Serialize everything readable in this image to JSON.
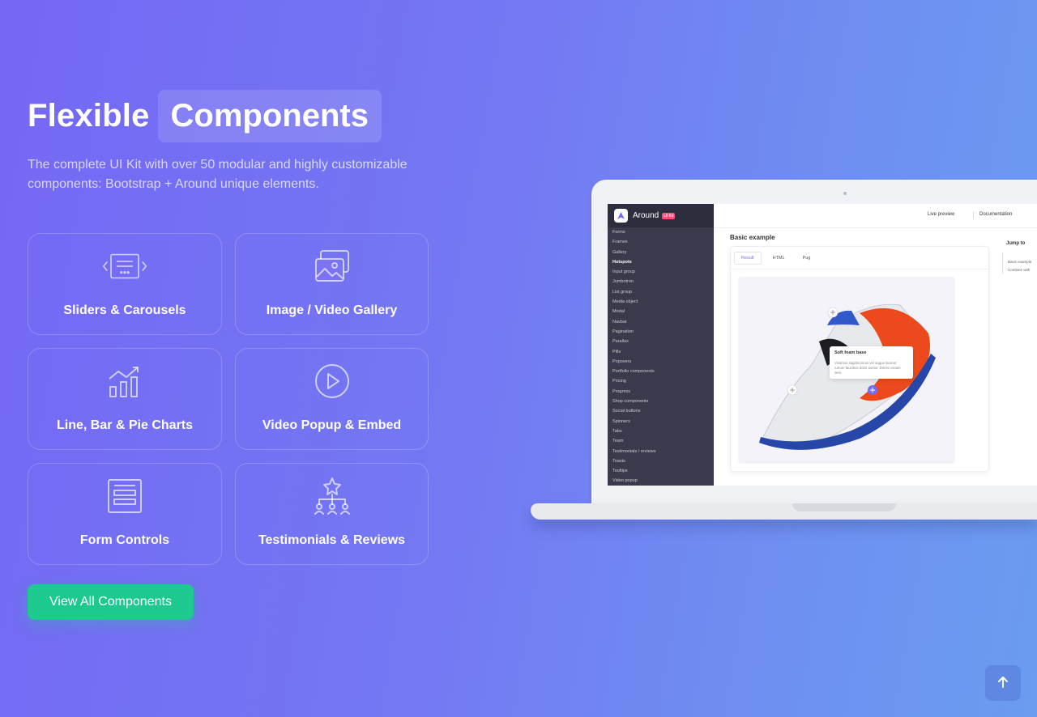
{
  "hero": {
    "title_plain": "Flexible",
    "title_highlight": "Components",
    "subtitle": "The complete UI Kit with over 50 modular and highly customizable components: Bootstrap + Around unique elements."
  },
  "cards": [
    {
      "label": "Sliders & Carousels",
      "icon": "slider-icon"
    },
    {
      "label": "Image / Video Gallery",
      "icon": "gallery-icon"
    },
    {
      "label": "Line, Bar & Pie Charts",
      "icon": "chart-icon"
    },
    {
      "label": "Video Popup & Embed",
      "icon": "play-icon"
    },
    {
      "label": "Form Controls",
      "icon": "form-icon"
    },
    {
      "label": "Testimonials & Reviews",
      "icon": "hierarchy-star-icon"
    }
  ],
  "cta": {
    "label": "View All Components"
  },
  "back_to_top": {
    "icon": "arrow-up-icon"
  },
  "colors": {
    "accent": "#1dc98f",
    "brand": "#766df4",
    "badge": "#f74f78"
  },
  "laptop": {
    "brand": "Around",
    "badge": "UI Kit",
    "topbar": {
      "live_preview": "Live preview",
      "documentation": "Documentation"
    },
    "sidebar_items": [
      "Forms",
      "Frames",
      "Gallery",
      "Hotspots",
      "Input group",
      "Jumbotron",
      "List group",
      "Media object",
      "Modal",
      "Navbar",
      "Pagination",
      "Parallax",
      "Pills",
      "Popovers",
      "Portfolio components",
      "Pricing",
      "Progress",
      "Shop components",
      "Social buttons",
      "Spinners",
      "Tabs",
      "Team",
      "Testimonials / reviews",
      "Toasts",
      "Tooltips",
      "Video popup"
    ],
    "active_item": "Hotspots",
    "heading": "Basic example",
    "tabs": [
      "Result",
      "HTML",
      "Pug"
    ],
    "active_tab": "Result",
    "hotspot": {
      "title": "Soft foam base",
      "text": "Vivamus sagittis lacus vel augue laoreet rutrum faucibus dolor auctor. Donec ornare sem."
    },
    "jump_to": {
      "title": "Jump to",
      "items": [
        "Basic example",
        "Combine with"
      ]
    }
  }
}
